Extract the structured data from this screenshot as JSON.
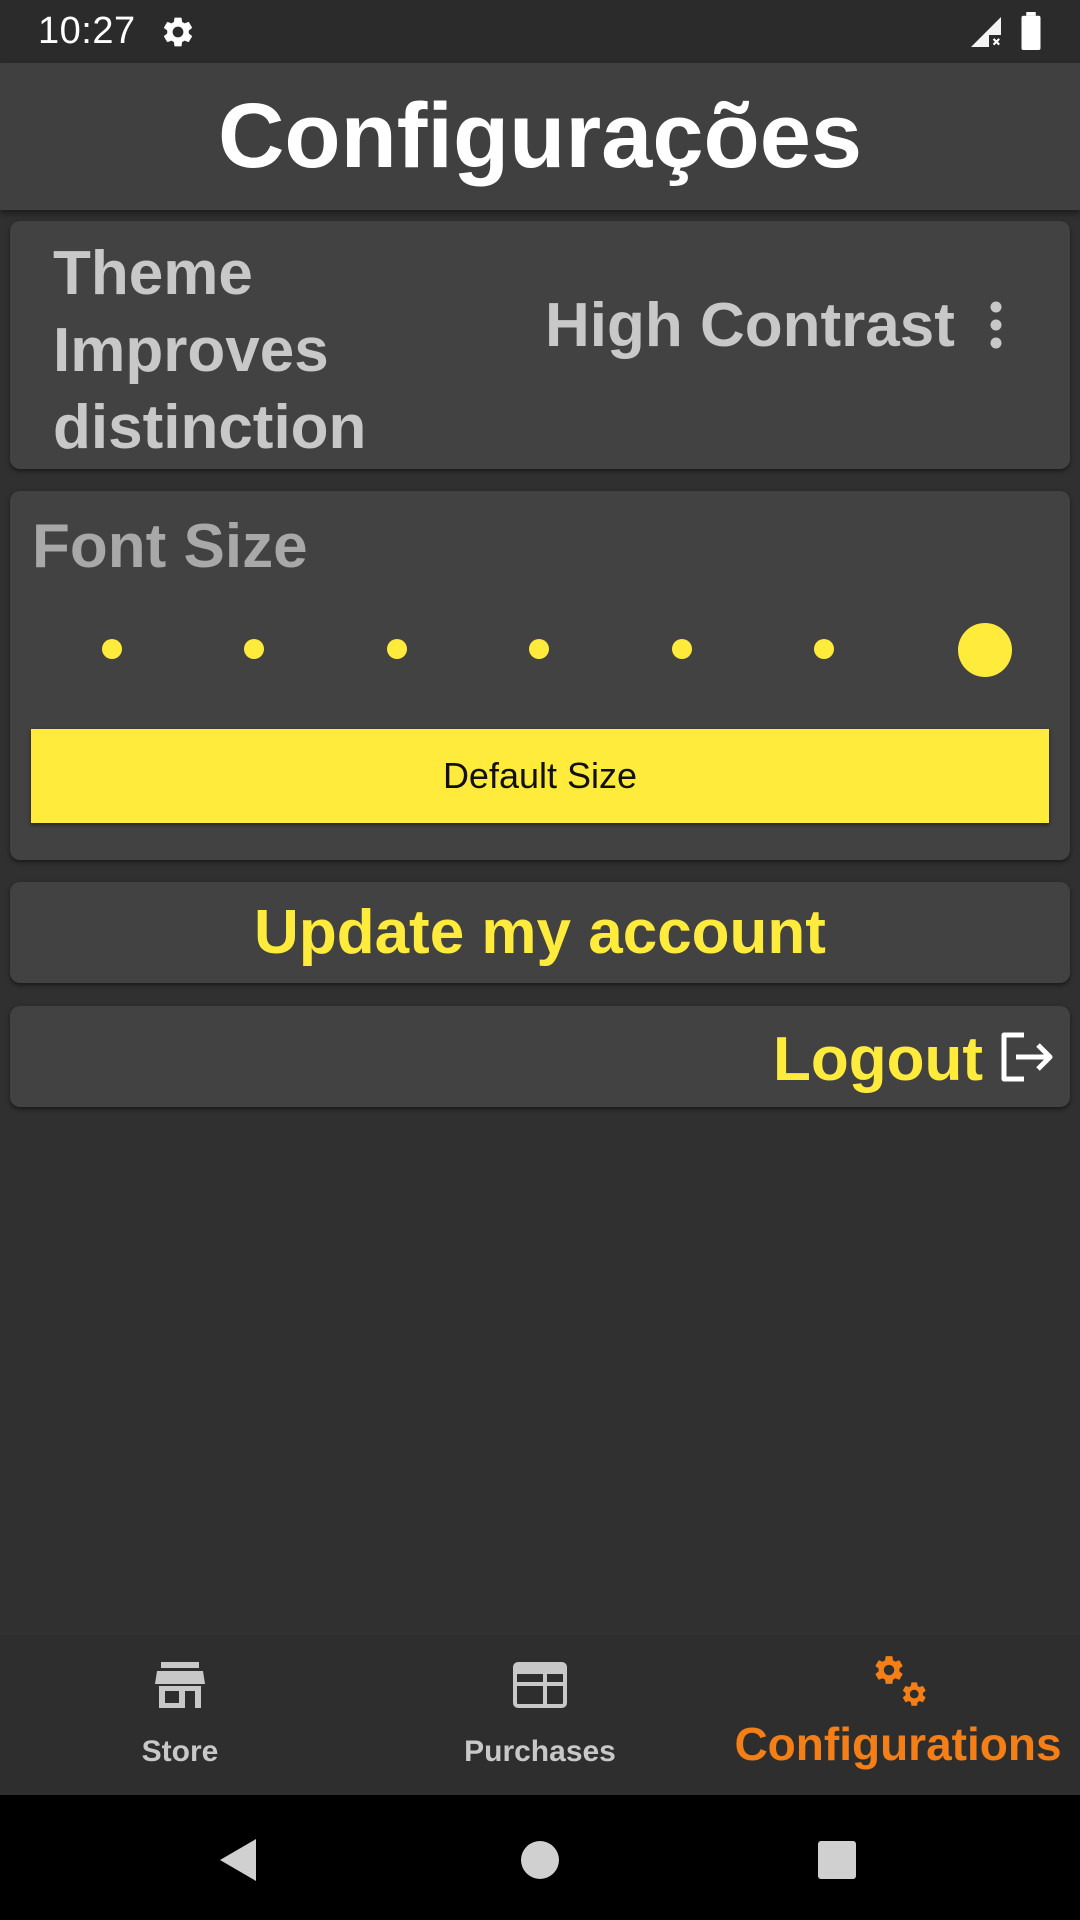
{
  "status_bar": {
    "time": "10:27",
    "icons": [
      "settings-gear-icon",
      "signal-no-service-icon",
      "battery-full-icon"
    ]
  },
  "header": {
    "title": "Configurações"
  },
  "theme_card": {
    "label": "Theme Improves distinction",
    "value": "High Contrast",
    "menu_icon": "more-vertical-icon"
  },
  "font_card": {
    "label": "Font Size",
    "slider": {
      "steps": 7,
      "selected_index": 6
    },
    "default_button": "Default Size"
  },
  "update_button": "Update my account",
  "logout": {
    "label": "Logout",
    "icon": "logout-icon"
  },
  "bottom_nav": {
    "items": [
      {
        "label": "Store",
        "icon": "store-icon",
        "active": false
      },
      {
        "label": "Purchases",
        "icon": "purchases-icon",
        "active": false
      },
      {
        "label": "Configurations",
        "icon": "settings-gears-icon",
        "active": true
      }
    ]
  },
  "colors": {
    "accent": "#ffeb3b",
    "active_nav": "#f57f17",
    "background": "#303030",
    "card": "#424242",
    "header": "#404040"
  },
  "system_nav": [
    "back-icon",
    "home-icon",
    "recents-icon"
  ]
}
